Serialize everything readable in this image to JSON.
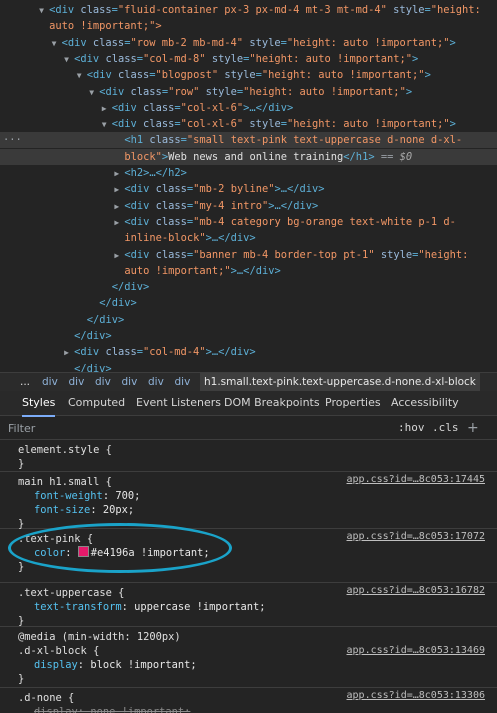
{
  "elements_tree": {
    "gutter_marker": "···",
    "lines": [
      {
        "indent": 4,
        "tri": "▼",
        "tag": "div",
        "attrs": [
          {
            "name": "class",
            "value": "\"fluid-container px-3 px-md-4 mt-3 mt-md-4\""
          },
          {
            "name": "style",
            "value": "\"height:"
          }
        ],
        "close": ""
      },
      {
        "indent": 4,
        "tri": "",
        "tag": "",
        "text_only": "auto !important;\">",
        "close": ""
      },
      {
        "indent": 6,
        "tri": "▼",
        "tag": "div",
        "attrs": [
          {
            "name": "class",
            "value": "\"row mb-2 mb-md-4\""
          },
          {
            "name": "style",
            "value": "\"height: auto !important;\""
          }
        ],
        "close": ">"
      },
      {
        "indent": 8,
        "tri": "▼",
        "tag": "div",
        "attrs": [
          {
            "name": "class",
            "value": "\"col-md-8\""
          },
          {
            "name": "style",
            "value": "\"height: auto !important;\""
          }
        ],
        "close": ">"
      },
      {
        "indent": 10,
        "tri": "▼",
        "tag": "div",
        "attrs": [
          {
            "name": "class",
            "value": "\"blogpost\""
          },
          {
            "name": "style",
            "value": "\"height: auto !important;\""
          }
        ],
        "close": ">"
      },
      {
        "indent": 12,
        "tri": "▼",
        "tag": "div",
        "attrs": [
          {
            "name": "class",
            "value": "\"row\""
          },
          {
            "name": "style",
            "value": "\"height: auto !important;\""
          }
        ],
        "close": ">"
      },
      {
        "indent": 14,
        "tri": "▶",
        "tag": "div",
        "attrs": [
          {
            "name": "class",
            "value": "\"col-xl-6\""
          }
        ],
        "close": ">…</div>"
      },
      {
        "indent": 14,
        "tri": "▼",
        "tag": "div",
        "attrs": [
          {
            "name": "class",
            "value": "\"col-xl-6\""
          },
          {
            "name": "style",
            "value": "\"height: auto !important;\""
          }
        ],
        "close": ">"
      },
      {
        "indent": 16,
        "tri": "",
        "tag": "h1",
        "attrs": [
          {
            "name": "class",
            "value": "\"small text-pink text-uppercase d-none d-xl-"
          }
        ],
        "close": "",
        "selected": true
      },
      {
        "indent": 16,
        "tri": "",
        "tag": "",
        "h1_cont": true,
        "cont_value": "block\"",
        "cont_text": "Web news and online training",
        "cont_close": "</h1>",
        "eq": " == ",
        "dollar": "$0",
        "selected": true
      },
      {
        "indent": 16,
        "tri": "▶",
        "tag": "h2",
        "attrs": [],
        "close": ">…</h2>"
      },
      {
        "indent": 16,
        "tri": "▶",
        "tag": "div",
        "attrs": [
          {
            "name": "class",
            "value": "\"mb-2 byline\""
          }
        ],
        "close": ">…</div>"
      },
      {
        "indent": 16,
        "tri": "▶",
        "tag": "div",
        "attrs": [
          {
            "name": "class",
            "value": "\"my-4 intro\""
          }
        ],
        "close": ">…</div>"
      },
      {
        "indent": 16,
        "tri": "▶",
        "tag": "div",
        "attrs": [
          {
            "name": "class",
            "value": "\"mb-4 category bg-orange text-white p-1 d-"
          }
        ],
        "close": ""
      },
      {
        "indent": 16,
        "tri": "",
        "tag": "",
        "text_av": "inline-block\"",
        "text_after": ">…</div>",
        "close": ""
      },
      {
        "indent": 16,
        "tri": "▶",
        "tag": "div",
        "attrs": [
          {
            "name": "class",
            "value": "\"banner mb-4 border-top pt-1\""
          },
          {
            "name": "style",
            "value": "\"height:"
          }
        ],
        "close": ""
      },
      {
        "indent": 16,
        "tri": "",
        "tag": "",
        "text_av": "auto !important;\"",
        "text_after": ">…</div>",
        "close": ""
      },
      {
        "indent": 14,
        "tri": "",
        "tag": "",
        "text_only": "</div>",
        "close": ""
      },
      {
        "indent": 12,
        "tri": "",
        "tag": "",
        "text_only": "</div>",
        "close": ""
      },
      {
        "indent": 10,
        "tri": "",
        "tag": "",
        "text_only": "</div>",
        "close": ""
      },
      {
        "indent": 8,
        "tri": "",
        "tag": "",
        "text_only": "</div>",
        "close": ""
      },
      {
        "indent": 8,
        "tri": "▶",
        "tag": "div",
        "attrs": [
          {
            "name": "class",
            "value": "\"col-md-4\""
          }
        ],
        "close": ">…</div>"
      },
      {
        "indent": 8,
        "tri": "",
        "tag": "",
        "text_only": "</div>",
        "close": ""
      },
      {
        "indent": 6,
        "tri": "",
        "tag": "",
        "text_only": "</div>",
        "close": ""
      },
      {
        "indent": 4,
        "tri": "",
        "tag": "",
        "text_only": "</div>",
        "close": ""
      },
      {
        "indent": 4,
        "tri": "▶",
        "tag": "div",
        "attrs": [
          {
            "name": "class",
            "value": "\"fluid-container\""
          }
        ],
        "close": ">…</div>"
      }
    ]
  },
  "breadcrumbs": {
    "ellipsis": "...",
    "items": [
      "div",
      "div",
      "div",
      "div",
      "div",
      "div",
      "div"
    ],
    "active": "h1.small.text-pink.text-uppercase.d-none.d-xl-block"
  },
  "tabs": [
    "Styles",
    "Computed",
    "Event Listeners",
    "DOM Breakpoints",
    "Properties",
    "Accessibility"
  ],
  "filter": {
    "placeholder": "Filter",
    "hov": ":hov",
    "cls": ".cls",
    "plus": "+"
  },
  "rules": [
    {
      "selector": "element.style {",
      "source": "",
      "props": [],
      "close": "}"
    },
    {
      "selector": "main h1.small {",
      "source": "app.css?id=…8c053:17445",
      "props": [
        {
          "name": "font-weight",
          "value": "700;"
        },
        {
          "name": "font-size",
          "value": "20px;"
        }
      ],
      "close": "}"
    },
    {
      "selector": ".text-pink {",
      "source": "app.css?id=…8c053:17072",
      "props": [
        {
          "name": "color",
          "value": "#e4196a !important;",
          "swatch": "#e4196a"
        }
      ],
      "close": "}"
    },
    {
      "selector": ".text-uppercase {",
      "source": "app.css?id=…8c053:16782",
      "props": [
        {
          "name": "text-transform",
          "value": "uppercase !important;"
        }
      ],
      "close": "}"
    },
    {
      "media": "@media (min-width: 1200px)",
      "selector": ".d-xl-block {",
      "source": "app.css?id=…8c053:13469",
      "props": [
        {
          "name": "display",
          "value": "block !important;"
        }
      ],
      "close": "}"
    },
    {
      "selector": ".d-none {",
      "source": "app.css?id=…8c053:13306",
      "props": [
        {
          "name": "display",
          "value": "none !important;",
          "struck": true
        }
      ],
      "close": ""
    }
  ]
}
